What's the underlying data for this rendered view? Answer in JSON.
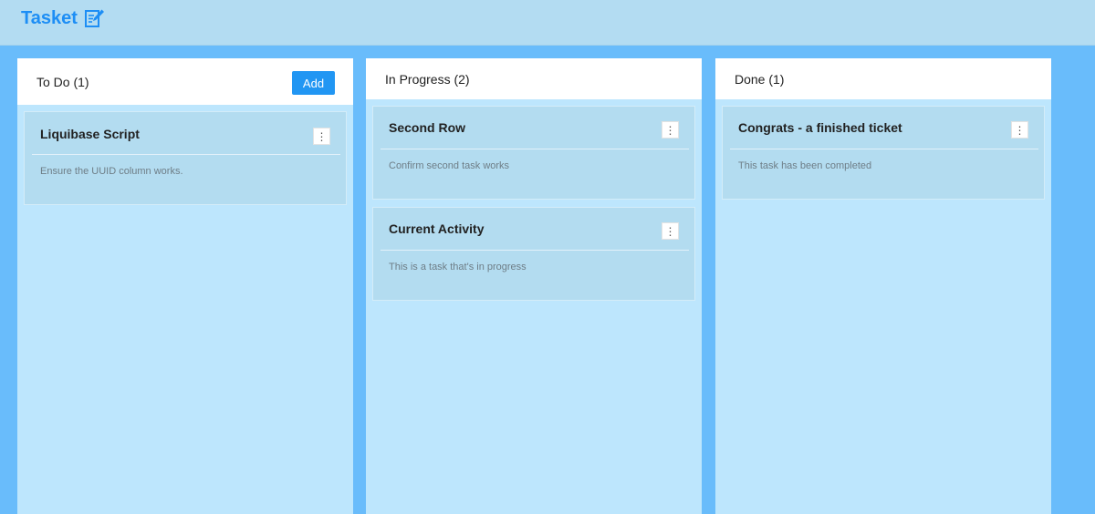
{
  "app": {
    "title": "Tasket",
    "logo_icon": "edit-document-icon",
    "brand_color": "#1d8ef5"
  },
  "columns": [
    {
      "title": "To Do (1)",
      "add_label": "Add",
      "cards": [
        {
          "title": "Liquibase Script",
          "description": "Ensure the UUID column works.",
          "menu_icon": "more-vertical-icon",
          "menu_glyph": "⋮"
        }
      ]
    },
    {
      "title": "In Progress (2)",
      "cards": [
        {
          "title": "Second Row",
          "description": "Confirm second task works",
          "menu_icon": "more-vertical-icon",
          "menu_glyph": "⋮"
        },
        {
          "title": "Current Activity",
          "description": "This is a task that's in progress",
          "menu_icon": "more-vertical-icon",
          "menu_glyph": "⋮"
        }
      ]
    },
    {
      "title": "Done (1)",
      "cards": [
        {
          "title": "Congrats - a finished ticket",
          "description": "This task has been completed",
          "menu_icon": "more-vertical-icon",
          "menu_glyph": "⋮"
        }
      ]
    }
  ],
  "colors": {
    "page_background": "#69bcfb",
    "topbar": "#b3dcf2",
    "column_background": "#bde6fd",
    "card_background": "#b3dcf0",
    "add_button": "#2196f3"
  }
}
